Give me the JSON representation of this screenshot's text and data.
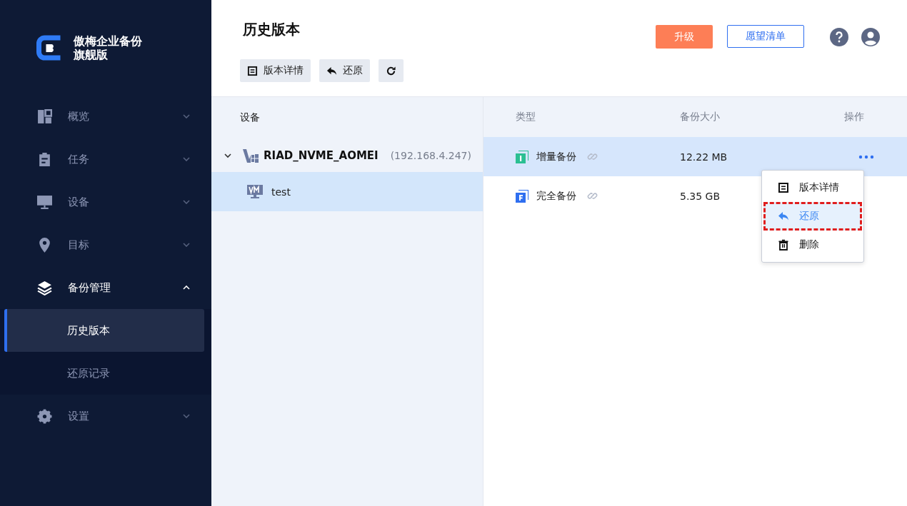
{
  "brand": {
    "lines": [
      "傲梅企业备份",
      "旗舰版"
    ]
  },
  "nav": [
    {
      "label": "概览",
      "kind": "overview",
      "expanded": false
    },
    {
      "label": "任务",
      "kind": "task",
      "expanded": false
    },
    {
      "label": "设备",
      "kind": "device",
      "expanded": false
    },
    {
      "label": "目标",
      "kind": "target",
      "expanded": false
    },
    {
      "label": "备份管理",
      "kind": "layers",
      "expanded": true,
      "children": [
        {
          "label": "历史版本",
          "selected": true
        },
        {
          "label": "还原记录",
          "selected": false
        }
      ]
    },
    {
      "label": "设置",
      "kind": "settings",
      "expanded": false
    }
  ],
  "page_title": "历史版本",
  "toolbar": [
    {
      "kind": "details",
      "label": "版本详情"
    },
    {
      "kind": "restore",
      "label": "还原"
    },
    {
      "kind": "refresh"
    }
  ],
  "header_buttons": {
    "upgrade": "升级",
    "wishlist": "愿望清单"
  },
  "devices": {
    "heading": "设备",
    "tree": [
      {
        "name": "RIAD_NVME_AOMEI",
        "ip": "(192.168.4.247)",
        "expanded": true,
        "children": [
          {
            "name": "test",
            "selected": true
          }
        ]
      }
    ]
  },
  "table": {
    "columns": [
      "类型",
      "备份大小",
      "操作"
    ],
    "rows": [
      {
        "kind": "incremental",
        "type": "增量备份",
        "size": "12.22 MB",
        "selected": true
      },
      {
        "kind": "full",
        "type": "完全备份",
        "size": "5.35 GB",
        "selected": false
      }
    ]
  },
  "context_menu": [
    {
      "kind": "details",
      "label": "版本详情",
      "selected": false
    },
    {
      "kind": "restore",
      "label": "还原",
      "selected": true
    },
    {
      "kind": "delete",
      "label": "删除",
      "selected": false
    }
  ]
}
